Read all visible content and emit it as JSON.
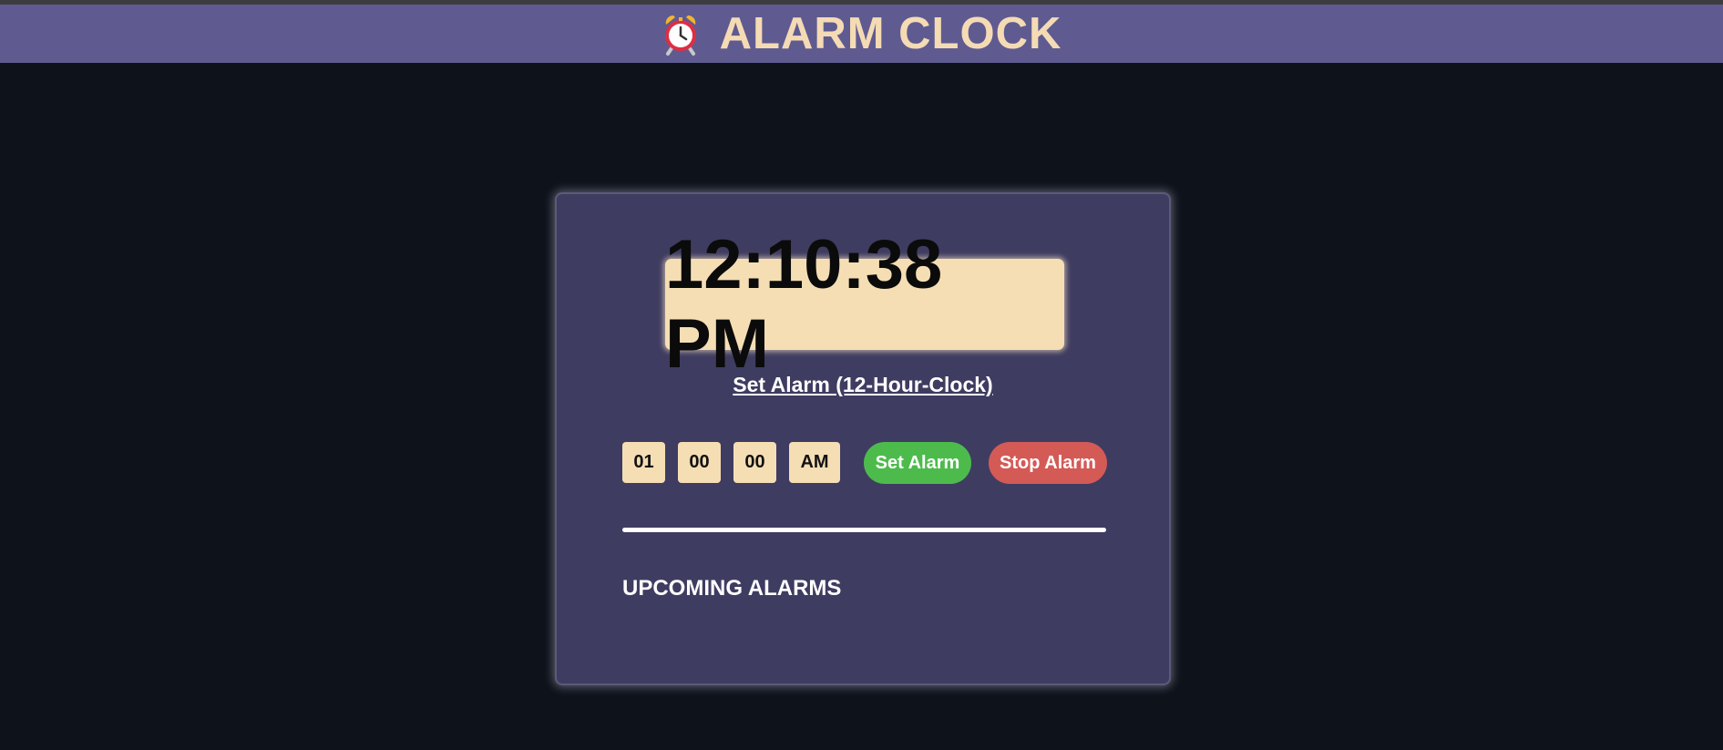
{
  "header": {
    "icon": "alarm-clock-icon",
    "title": "ALARM CLOCK"
  },
  "clock": {
    "current_time": "12:10:38 PM"
  },
  "alarm_form": {
    "heading_link": "Set Alarm (12-Hour-Clock)",
    "hour": "01",
    "minute": "00",
    "second": "00",
    "period": "AM",
    "set_label": "Set Alarm",
    "stop_label": "Stop Alarm"
  },
  "upcoming": {
    "heading": "UPCOMING ALARMS"
  },
  "colors": {
    "background": "#0e131b",
    "header_bg": "#5f5b91",
    "accent_text": "#f5dbb4",
    "card_bg": "#3f3c61",
    "display_bg": "#f5deb4",
    "set_button": "#4dbb4c",
    "stop_button": "#d45a56"
  }
}
